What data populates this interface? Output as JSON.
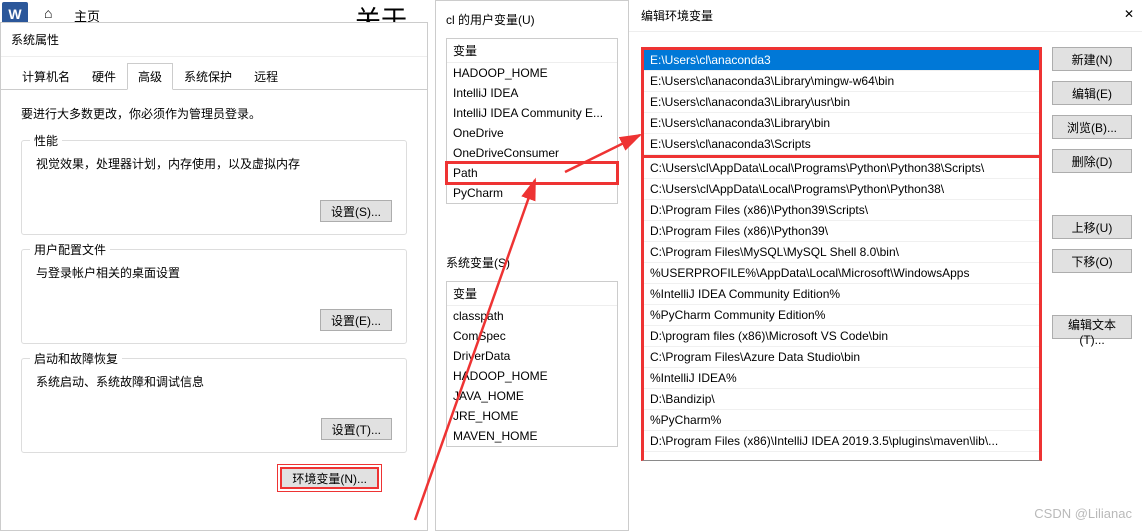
{
  "word_icon_letter": "W",
  "home_label": "主页",
  "guanyu_text": "关于",
  "sysprop": {
    "title": "系统属性",
    "tabs": [
      "计算机名",
      "硬件",
      "高级",
      "系统保护",
      "远程"
    ],
    "admin_note": "要进行大多数更改，你必须作为管理员登录。",
    "perf": {
      "label": "性能",
      "desc": "视觉效果，处理器计划，内存使用，以及虚拟内存",
      "btn": "设置(S)..."
    },
    "profile": {
      "label": "用户配置文件",
      "desc": "与登录帐户相关的桌面设置",
      "btn": "设置(E)..."
    },
    "startup": {
      "label": "启动和故障恢复",
      "desc": "系统启动、系统故障和调试信息",
      "btn": "设置(T)..."
    },
    "env_btn": "环境变量(N)..."
  },
  "envvars": {
    "user_title": "cl 的用户变量(U)",
    "header": "变量",
    "user_vars": [
      "HADOOP_HOME",
      "IntelliJ IDEA",
      "IntelliJ IDEA Community E...",
      "OneDrive",
      "OneDriveConsumer",
      "Path",
      "PyCharm"
    ],
    "sys_title": "系统变量(S)",
    "sys_header": "变量",
    "sys_vars": [
      "classpath",
      "ComSpec",
      "DriverData",
      "HADOOP_HOME",
      "JAVA_HOME",
      "JRE_HOME",
      "MAVEN_HOME"
    ]
  },
  "editenv": {
    "title": "编辑环境变量",
    "paths_top": [
      "E:\\Users\\cl\\anaconda3",
      "E:\\Users\\cl\\anaconda3\\Library\\mingw-w64\\bin",
      "E:\\Users\\cl\\anaconda3\\Library\\usr\\bin",
      "E:\\Users\\cl\\anaconda3\\Library\\bin",
      "E:\\Users\\cl\\anaconda3\\Scripts"
    ],
    "paths_rest": [
      "C:\\Users\\cl\\AppData\\Local\\Programs\\Python\\Python38\\Scripts\\",
      "C:\\Users\\cl\\AppData\\Local\\Programs\\Python\\Python38\\",
      "D:\\Program Files (x86)\\Python39\\Scripts\\",
      "D:\\Program Files (x86)\\Python39\\",
      "C:\\Program Files\\MySQL\\MySQL Shell 8.0\\bin\\",
      "%USERPROFILE%\\AppData\\Local\\Microsoft\\WindowsApps",
      "%IntelliJ IDEA Community Edition%",
      "%PyCharm Community Edition%",
      "D:\\program files (x86)\\Microsoft VS Code\\bin",
      "C:\\Program Files\\Azure Data Studio\\bin",
      "%IntelliJ IDEA%",
      "D:\\Bandizip\\",
      "%PyCharm%",
      "D:\\Program Files (x86)\\IntelliJ IDEA 2019.3.5\\plugins\\maven\\lib\\..."
    ],
    "buttons": {
      "new": "新建(N)",
      "edit": "编辑(E)",
      "browse": "浏览(B)...",
      "delete": "删除(D)",
      "up": "上移(U)",
      "down": "下移(O)",
      "edit_text": "编辑文本(T)..."
    }
  },
  "watermark": "CSDN @Lilianac"
}
